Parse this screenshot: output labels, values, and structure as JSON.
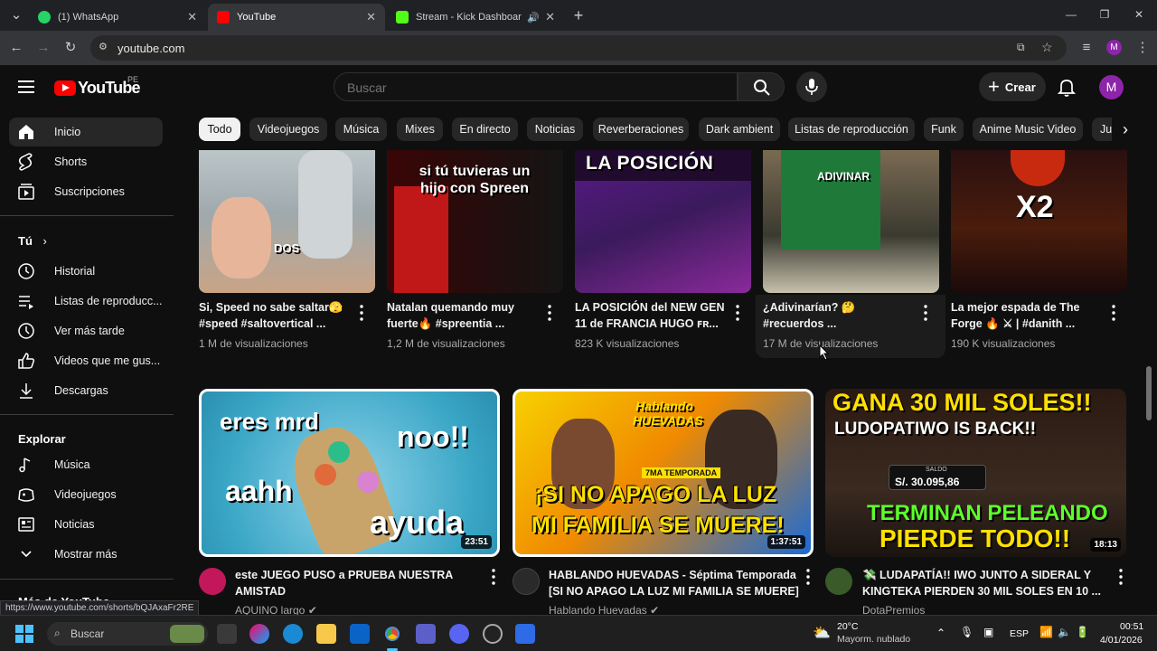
{
  "browser": {
    "tabs": [
      {
        "title": "(1) WhatsApp",
        "active": false
      },
      {
        "title": "YouTube",
        "active": true
      },
      {
        "title": "Stream - Kick Dashboard",
        "active": false
      }
    ],
    "url": "youtube.com",
    "profile_initial": "M"
  },
  "header": {
    "logo_text": "YouTube",
    "region": "PE",
    "search_placeholder": "Buscar",
    "create_label": "Crear",
    "avatar_initial": "M"
  },
  "sidebar": {
    "items": [
      {
        "label": "Inicio",
        "icon": "home-icon"
      },
      {
        "label": "Shorts",
        "icon": "shorts-icon"
      },
      {
        "label": "Suscripciones",
        "icon": "subscriptions-icon"
      }
    ],
    "you_title": "Tú",
    "you_items": [
      {
        "label": "Historial",
        "icon": "history-icon"
      },
      {
        "label": "Listas de reproducc...",
        "icon": "playlists-icon"
      },
      {
        "label": "Ver más tarde",
        "icon": "watch-later-icon"
      },
      {
        "label": "Videos que me gus...",
        "icon": "like-icon"
      },
      {
        "label": "Descargas",
        "icon": "download-icon"
      }
    ],
    "explore_title": "Explorar",
    "explore_items": [
      {
        "label": "Música",
        "icon": "music-icon"
      },
      {
        "label": "Videojuegos",
        "icon": "gaming-icon"
      },
      {
        "label": "Noticias",
        "icon": "news-icon"
      },
      {
        "label": "Mostrar más",
        "icon": "chevron-down-icon"
      }
    ],
    "more_title": "Más de YouTube"
  },
  "chips": [
    "Todo",
    "Videojuegos",
    "Música",
    "Mixes",
    "En directo",
    "Noticias",
    "Reverberaciones",
    "Dark ambient",
    "Listas de reproducción",
    "Funk",
    "Anime Music Video",
    "Ju"
  ],
  "shorts": [
    {
      "title1": "Si, Speed no sabe saltar🫣",
      "title2": "#speed #saltovertical ...",
      "views": "1 M de visualizaciones",
      "overlay": "DOS"
    },
    {
      "title1": "Natalan quemando muy",
      "title2": "fuerte🔥 #spreentia ...",
      "views": "1,2 M de visualizaciones",
      "overlay": "si tú tuvieras un hijo con Spreen"
    },
    {
      "title1": "LA POSICIÓN del NEW GEN",
      "title2": "11 de FRANCIA HUGO ꜰʀ...",
      "views": "823 K visualizaciones",
      "overlay": "LA POSICIÓN"
    },
    {
      "title1": "¿Adivinarían? 🤔",
      "title2": "#recuerdos ...",
      "views": "17 M de visualizaciones",
      "overlay": "ADIVINAR"
    },
    {
      "title1": "La mejor espada de The",
      "title2": "Forge 🔥 ⚔ | #danith ...",
      "views": "190 K visualizaciones",
      "overlay": "X2"
    }
  ],
  "videos": [
    {
      "title1": "este JUEGO PUSO a PRUEBA NUESTRA",
      "title2": "AMISTAD",
      "channel": "AQUINO largo",
      "duration": "23:51",
      "thumb_lines": [
        "eres mrd",
        "noo!!",
        "aahh",
        "ayuda"
      ]
    },
    {
      "title1": "HABLANDO HUEVADAS - Séptima Temporada",
      "title2": "[SI NO APAGO LA LUZ MI FAMILIA SE MUERE]",
      "channel": "Hablando Huevadas",
      "duration": "1:37:51",
      "thumb_lines": [
        "Hablando HUEVADAS",
        "7MA TEMPORADA",
        "¡SI NO APAGO LA LUZ",
        "MI FAMILIA SE MUERE!"
      ]
    },
    {
      "title1": "💸 LUDAPATÍA!! IWO JUNTO A SIDERAL Y",
      "title2": "KINGTEKA PIERDEN 30 MIL SOLES EN 10 ...",
      "channel": "DotaPremios",
      "duration": "18:13",
      "thumb_lines": [
        "GANA 30 MIL SOLES!!",
        "LUDOPATIWO IS BACK!!",
        "SALDO",
        "S/. 30.095,86",
        "TERMINAN PELEANDO",
        "PIERDE TODO!!"
      ]
    }
  ],
  "status_url": "https://www.youtube.com/shorts/bQJAxaFr2RE",
  "taskbar": {
    "search_placeholder": "Buscar",
    "weather_temp": "20°C",
    "weather_desc": "Mayorm. nublado",
    "lang": "ESP",
    "time": "00:51",
    "date": "4/01/2026"
  }
}
